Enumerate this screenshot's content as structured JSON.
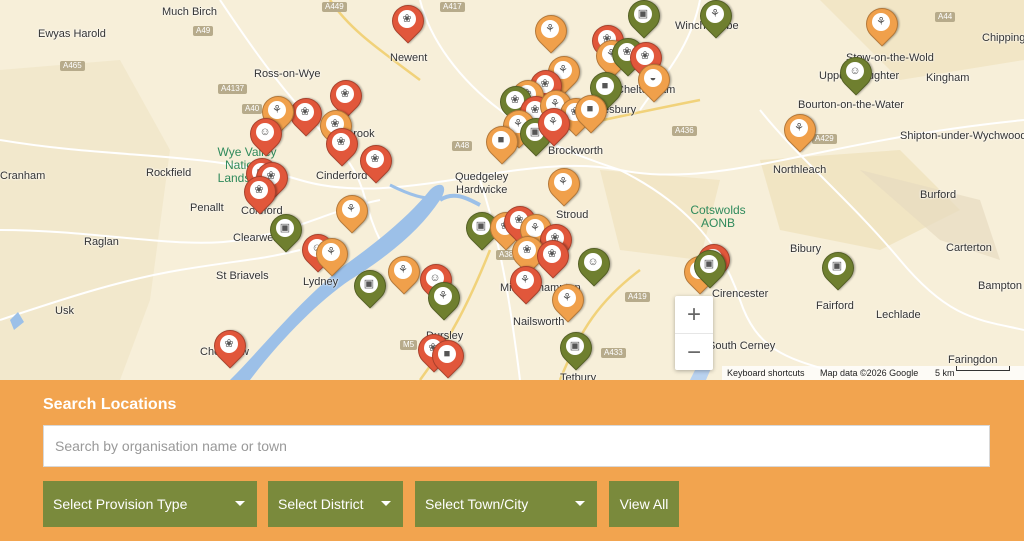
{
  "map": {
    "places": [
      "Much Birch",
      "Ewyas Harold",
      "Newent",
      "Winchcombe",
      "Stow-on-the-Wold",
      "Chipping Norton",
      "Kingham",
      "Ross-on-Wye",
      "Bourton-on-the-Water",
      "Upper Slaughter",
      "Shipton-under-Wychwood",
      "Cheltenham",
      "Cinderford",
      "Brockworth",
      "Northleach",
      "Rockfield",
      "Quedgeley",
      "Hardwicke",
      "Burford",
      "Penallt",
      "Coleford",
      "Stroud",
      "Raglan",
      "Clearwell",
      "Bibury",
      "Carterton",
      "St Briavels",
      "Lydney",
      "Cirencester",
      "Fairford",
      "Bampton",
      "Usk",
      "Minchinhampton",
      "Nailsworth",
      "Lechlade",
      "South Cerney",
      "Dursley",
      "Chepstow",
      "Faringdon",
      "Tetbury",
      "Tewkesbury",
      "Drybrook",
      "Cranham"
    ],
    "parks": [
      "Wye Valley National Landscape",
      "Cotswolds AONB"
    ],
    "roads": [
      "A449",
      "A49",
      "A417",
      "A465",
      "A4137",
      "A40",
      "A48",
      "A436",
      "A429",
      "A44",
      "A419",
      "A433",
      "M5",
      "A38"
    ],
    "zoom_in": "+",
    "zoom_out": "−",
    "attribution": {
      "shortcuts": "Keyboard shortcuts",
      "data": "Map data ©2026 Google",
      "scale": "5 km"
    }
  },
  "search": {
    "title": "Search Locations",
    "placeholder": "Search by organisation name or town",
    "value": "",
    "provision_label": "Select Provision Type",
    "district_label": "Select District",
    "town_label": "Select Town/City",
    "view_all_label": "View All"
  },
  "colors": {
    "panel_bg": "#f2a44f",
    "control_bg": "#7a8a3c",
    "pin_orange": "#f0a04b",
    "pin_red": "#e1573b",
    "pin_green": "#6f7f2f",
    "park_text": "#2f8a5c"
  },
  "icons": [
    "plate-cutlery-icon",
    "plant-pot-icon",
    "basket-icon",
    "people-icon",
    "bag-icon",
    "pot-icon"
  ]
}
